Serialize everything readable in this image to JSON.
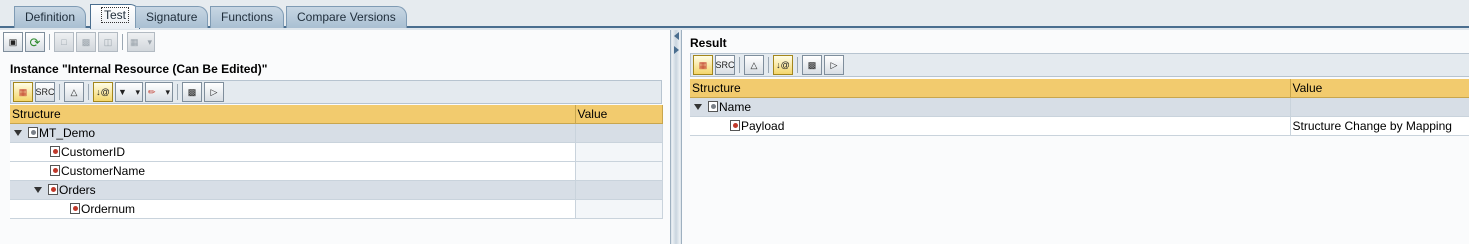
{
  "tabs": [
    {
      "label": "Definition",
      "active": false
    },
    {
      "label": "Test",
      "active": true
    },
    {
      "label": "Signature",
      "active": false
    },
    {
      "label": "Functions",
      "active": false
    },
    {
      "label": "Compare Versions",
      "active": false
    }
  ],
  "left": {
    "title": "Instance \"Internal Resource (Can Be Edited)\"",
    "toolbar_icons": [
      "load-instance-icon",
      "execute-test-icon",
      "new-icon",
      "save-icon",
      "delete-icon",
      "display-queue-icon"
    ],
    "grid_toolbar_icons": [
      "table-view-icon",
      "xml-source-icon",
      "collapse-icon",
      "insert-node-icon",
      "filter-icon",
      "edit-icon",
      "find-icon",
      "find-next-icon"
    ],
    "columns": [
      "Structure",
      "Value"
    ],
    "rows": [
      {
        "label": "MT_Demo",
        "value": ""
      },
      {
        "label": "CustomerID",
        "value": ""
      },
      {
        "label": "CustomerName",
        "value": ""
      },
      {
        "label": "Orders",
        "value": ""
      },
      {
        "label": "Ordernum",
        "value": ""
      }
    ]
  },
  "right": {
    "title": "Result",
    "grid_toolbar_icons": [
      "table-view-icon",
      "xml-source-icon",
      "collapse-icon",
      "insert-node-icon",
      "find-icon",
      "find-next-icon"
    ],
    "columns": [
      "Structure",
      "Value"
    ],
    "rows": [
      {
        "label": "Name",
        "value": ""
      },
      {
        "label": "Payload",
        "value": "Structure Change by Mapping"
      }
    ]
  },
  "colors": {
    "tab_active": "#ffffff",
    "tab_inactive": "#b6c9da",
    "grid_header": "#f2cb6e",
    "group_row": "#d7dee6"
  }
}
